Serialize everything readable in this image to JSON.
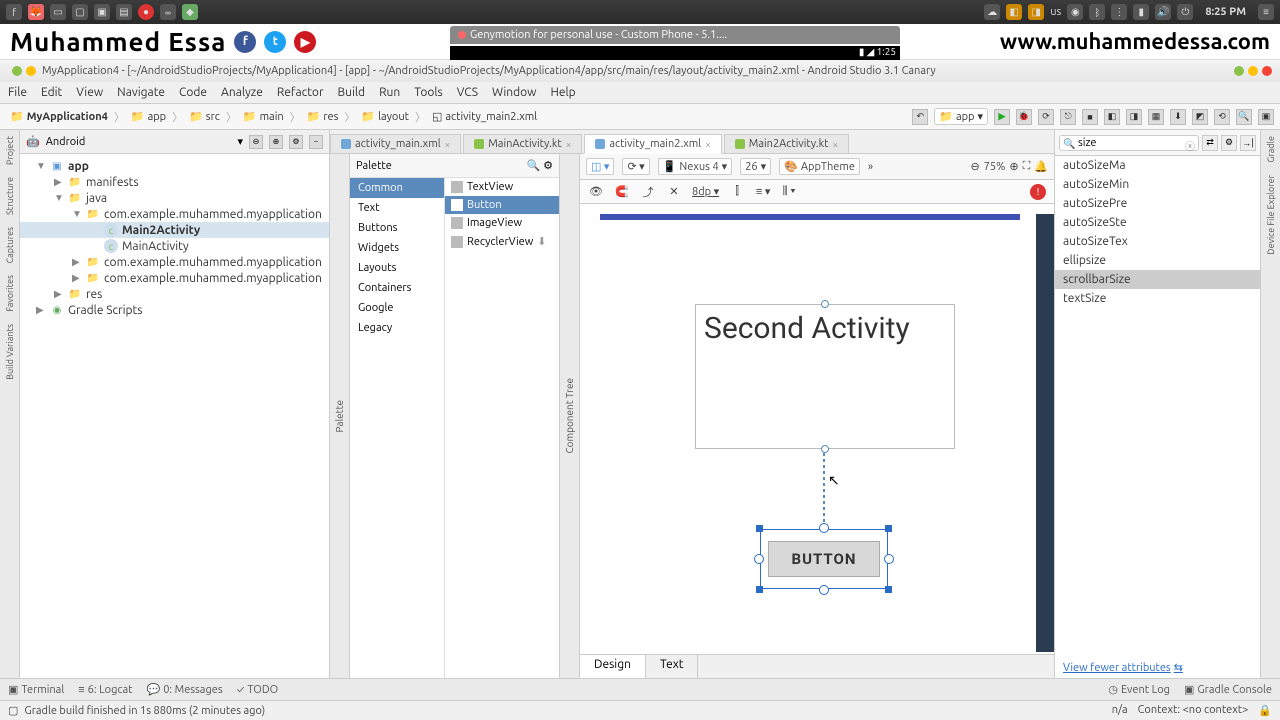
{
  "os": {
    "lang": "us",
    "time": "8:25 PM"
  },
  "banner": {
    "name": "Muhammed Essa",
    "geny_title": "Genymotion for personal use - Custom Phone - 5.1....",
    "phone_time": "1:25",
    "site": "www.muhammedessa.com"
  },
  "window": {
    "title": "MyApplication4 - [~/AndroidStudioProjects/MyApplication4] - [app] - ~/AndroidStudioProjects/MyApplication4/app/src/main/res/layout/activity_main2.xml - Android Studio 3.1 Canary"
  },
  "menu": [
    "File",
    "Edit",
    "View",
    "Navigate",
    "Code",
    "Analyze",
    "Refactor",
    "Build",
    "Run",
    "Tools",
    "VCS",
    "Window",
    "Help"
  ],
  "crumbs": [
    "MyApplication4",
    "app",
    "src",
    "main",
    "res",
    "layout",
    "activity_main2.xml"
  ],
  "run_config": "app",
  "project": {
    "view": "Android",
    "tree": {
      "app": "app",
      "manifests": "manifests",
      "java": "java",
      "pkg1": "com.example.muhammed.myapplication",
      "main2": "Main2Activity",
      "mainact": "MainActivity",
      "pkg2": "com.example.muhammed.myapplication",
      "pkg3": "com.example.muhammed.myapplication",
      "res": "res",
      "gradle": "Gradle Scripts"
    }
  },
  "tabs": [
    {
      "label": "activity_main.xml",
      "active": false
    },
    {
      "label": "MainActivity.kt",
      "active": false
    },
    {
      "label": "activity_main2.xml",
      "active": true
    },
    {
      "label": "Main2Activity.kt",
      "active": false
    }
  ],
  "palette": {
    "title": "Palette",
    "cats": [
      "Common",
      "Text",
      "Buttons",
      "Widgets",
      "Layouts",
      "Containers",
      "Google",
      "Legacy"
    ],
    "items": [
      "TextView",
      "Button",
      "ImageView",
      "RecyclerView"
    ]
  },
  "design_toolbar": {
    "device": "Nexus 4",
    "api": "26",
    "theme": "AppTheme",
    "zoom": "75%",
    "dp": "8dp"
  },
  "canvas": {
    "textview": "Second Activity",
    "button": "BUTTON"
  },
  "design_tabs": {
    "design": "Design",
    "text": "Text"
  },
  "attrs": {
    "search": "size",
    "list": [
      "autoSizeMa",
      "autoSizeMin",
      "autoSizePre",
      "autoSizeSte",
      "autoSizeTex",
      "ellipsize",
      "scrollbarSize",
      "textSize"
    ],
    "selected": "scrollbarSize",
    "link": "View fewer attributes"
  },
  "side_left": [
    "Project",
    "Structure",
    "Captures",
    "Favorites",
    "Build Variants"
  ],
  "side_right": [
    "Gradle",
    "Device File Explorer"
  ],
  "bottom": [
    "Terminal",
    "6: Logcat",
    "0: Messages",
    "TODO"
  ],
  "bottom_right": [
    "Event Log",
    "Gradle Console"
  ],
  "status": {
    "msg": "Gradle build finished in 1s 880ms (2 minutes ago)",
    "ctx": "Context: <no context>",
    "na": "n/a"
  },
  "comp_tree_label": "Component Tree"
}
